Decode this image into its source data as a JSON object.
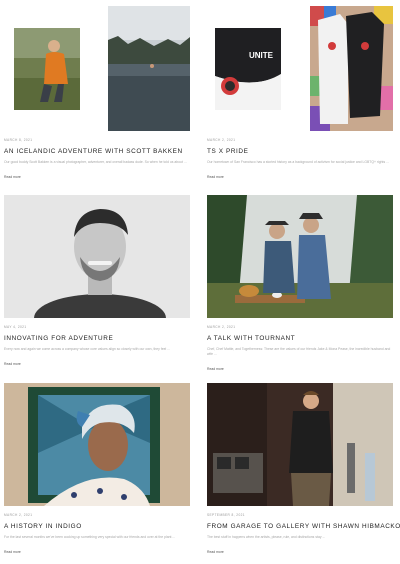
{
  "cards": [
    {
      "date": "MARCH 8, 2021",
      "title": "AN ICELANDIC ADVENTURE WITH SCOTT BAKKEN",
      "excerpt": "Our good buddy Scott Bakken is a visual photographer, adventurer, and overall badass dude. So when he told us about ...",
      "read_more": "Read more"
    },
    {
      "date": "MARCH 2, 2021",
      "title": "TS X PRIDE",
      "excerpt": "Our hometown of San Francisco has a storied history as a background of activism for social justice and LGBTQ+ rights ...",
      "read_more": "Read more"
    },
    {
      "date": "MAY 4, 2021",
      "title": "INNOVATING FOR ADVENTURE",
      "excerpt": "Every now and again we come across a company whose core values align so closely with our own, they feel ...",
      "read_more": "Read more"
    },
    {
      "date": "MARCH 2, 2021",
      "title": "A TALK WITH TOURNANT",
      "excerpt": "Chef, Chef Mattie, and Togetherness: These are the values of our friends Jake & Mona Pease, the incredible husband and wife ...",
      "read_more": "Read more"
    },
    {
      "date": "MARCH 2, 2021",
      "title": "A HISTORY IN INDIGO",
      "excerpt": "For the last several months we've been cooking up something very special with our friends and over at the plant ...",
      "read_more": "Read more"
    },
    {
      "date": "SEPTEMBER 8, 2021",
      "title": "FROM GARAGE TO GALLERY WITH SHAWN HIBMACKONAN",
      "excerpt": "The best stuff in happens when the artists, please, rule, and distinctions stay ...",
      "read_more": "Read more"
    }
  ],
  "images": {
    "ts_pride_logo": "UNITE"
  }
}
